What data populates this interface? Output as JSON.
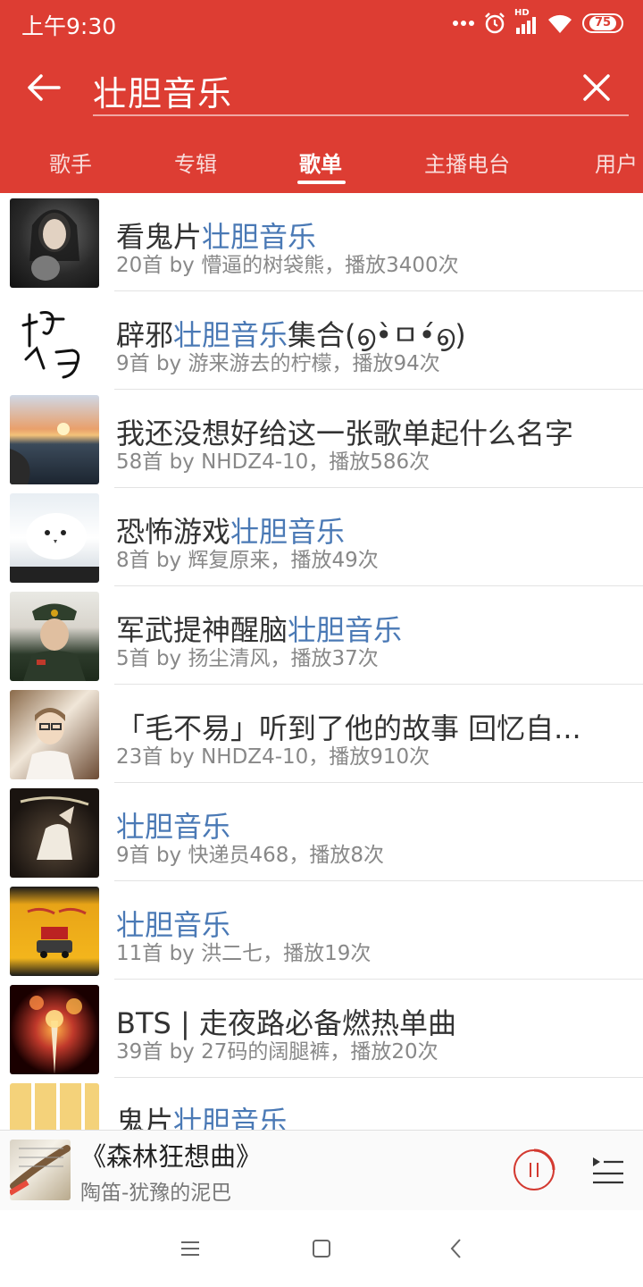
{
  "status_bar": {
    "time": "上午9:30",
    "battery": "75",
    "network": "HD"
  },
  "search": {
    "query": "壮胆音乐"
  },
  "tabs": [
    {
      "label": "歌手",
      "active": false
    },
    {
      "label": "专辑",
      "active": false
    },
    {
      "label": "歌单",
      "active": true
    },
    {
      "label": "主播电台",
      "active": false
    },
    {
      "label": "用户",
      "active": false
    }
  ],
  "playlists": [
    {
      "title_pre": "看鬼片",
      "title_hl": "壮胆音乐",
      "title_post": "",
      "meta": "20首  by 懵逼的树袋熊，播放3400次"
    },
    {
      "title_pre": "辟邪",
      "title_hl": "壮胆音乐",
      "title_post": "集合(൭•̀ㅁ•́൭)",
      "meta": "9首  by 游来游去的柠檬，播放94次"
    },
    {
      "title_pre": "我还没想好给这一张歌单起什么名字",
      "title_hl": "",
      "title_post": "",
      "meta": "58首  by NHDZ4-10，播放586次"
    },
    {
      "title_pre": "恐怖游戏",
      "title_hl": "壮胆音乐",
      "title_post": "",
      "meta": "8首  by 辉复原来，播放49次"
    },
    {
      "title_pre": "军武提神醒脑",
      "title_hl": "壮胆音乐",
      "title_post": "",
      "meta": "5首  by 扬尘清风，播放37次"
    },
    {
      "title_pre": "「毛不易」听到了他的故事 回忆自...",
      "title_hl": "",
      "title_post": "",
      "meta": "23首  by NHDZ4-10，播放910次"
    },
    {
      "title_pre": "",
      "title_hl": "壮胆音乐",
      "title_post": "",
      "meta": "9首  by 快递员468，播放8次"
    },
    {
      "title_pre": "",
      "title_hl": "壮胆音乐",
      "title_post": "",
      "meta": "11首  by 洪二七，播放19次"
    },
    {
      "title_pre": "BTS | 走夜路必备燃热单曲",
      "title_hl": "",
      "title_post": "",
      "meta": "39首  by 27码的阔腿裤，播放20次"
    },
    {
      "title_pre": "鬼片",
      "title_hl": "壮胆音乐",
      "title_post": "",
      "meta": ""
    }
  ],
  "player": {
    "title": "《森林狂想曲》",
    "subtitle": "陶笛-犹豫的泥巴"
  },
  "colors": {
    "header_bg": "#dd3d33",
    "highlight": "#4a79b5",
    "accent_red": "#d33a31"
  }
}
